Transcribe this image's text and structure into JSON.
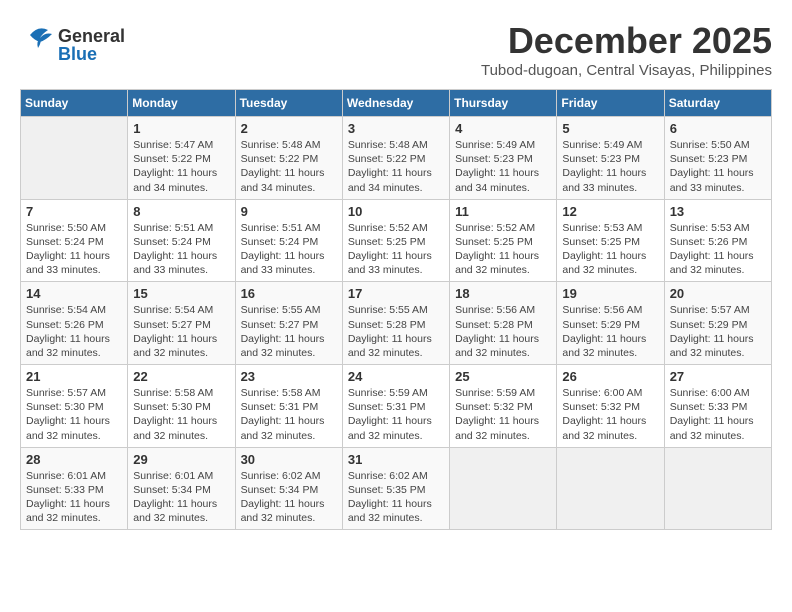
{
  "header": {
    "logo_general": "General",
    "logo_blue": "Blue",
    "month": "December 2025",
    "location": "Tubod-dugoan, Central Visayas, Philippines"
  },
  "columns": [
    "Sunday",
    "Monday",
    "Tuesday",
    "Wednesday",
    "Thursday",
    "Friday",
    "Saturday"
  ],
  "weeks": [
    [
      {
        "day": "",
        "info": ""
      },
      {
        "day": "1",
        "info": "Sunrise: 5:47 AM\nSunset: 5:22 PM\nDaylight: 11 hours\nand 34 minutes."
      },
      {
        "day": "2",
        "info": "Sunrise: 5:48 AM\nSunset: 5:22 PM\nDaylight: 11 hours\nand 34 minutes."
      },
      {
        "day": "3",
        "info": "Sunrise: 5:48 AM\nSunset: 5:22 PM\nDaylight: 11 hours\nand 34 minutes."
      },
      {
        "day": "4",
        "info": "Sunrise: 5:49 AM\nSunset: 5:23 PM\nDaylight: 11 hours\nand 34 minutes."
      },
      {
        "day": "5",
        "info": "Sunrise: 5:49 AM\nSunset: 5:23 PM\nDaylight: 11 hours\nand 33 minutes."
      },
      {
        "day": "6",
        "info": "Sunrise: 5:50 AM\nSunset: 5:23 PM\nDaylight: 11 hours\nand 33 minutes."
      }
    ],
    [
      {
        "day": "7",
        "info": "Sunrise: 5:50 AM\nSunset: 5:24 PM\nDaylight: 11 hours\nand 33 minutes."
      },
      {
        "day": "8",
        "info": "Sunrise: 5:51 AM\nSunset: 5:24 PM\nDaylight: 11 hours\nand 33 minutes."
      },
      {
        "day": "9",
        "info": "Sunrise: 5:51 AM\nSunset: 5:24 PM\nDaylight: 11 hours\nand 33 minutes."
      },
      {
        "day": "10",
        "info": "Sunrise: 5:52 AM\nSunset: 5:25 PM\nDaylight: 11 hours\nand 33 minutes."
      },
      {
        "day": "11",
        "info": "Sunrise: 5:52 AM\nSunset: 5:25 PM\nDaylight: 11 hours\nand 32 minutes."
      },
      {
        "day": "12",
        "info": "Sunrise: 5:53 AM\nSunset: 5:25 PM\nDaylight: 11 hours\nand 32 minutes."
      },
      {
        "day": "13",
        "info": "Sunrise: 5:53 AM\nSunset: 5:26 PM\nDaylight: 11 hours\nand 32 minutes."
      }
    ],
    [
      {
        "day": "14",
        "info": "Sunrise: 5:54 AM\nSunset: 5:26 PM\nDaylight: 11 hours\nand 32 minutes."
      },
      {
        "day": "15",
        "info": "Sunrise: 5:54 AM\nSunset: 5:27 PM\nDaylight: 11 hours\nand 32 minutes."
      },
      {
        "day": "16",
        "info": "Sunrise: 5:55 AM\nSunset: 5:27 PM\nDaylight: 11 hours\nand 32 minutes."
      },
      {
        "day": "17",
        "info": "Sunrise: 5:55 AM\nSunset: 5:28 PM\nDaylight: 11 hours\nand 32 minutes."
      },
      {
        "day": "18",
        "info": "Sunrise: 5:56 AM\nSunset: 5:28 PM\nDaylight: 11 hours\nand 32 minutes."
      },
      {
        "day": "19",
        "info": "Sunrise: 5:56 AM\nSunset: 5:29 PM\nDaylight: 11 hours\nand 32 minutes."
      },
      {
        "day": "20",
        "info": "Sunrise: 5:57 AM\nSunset: 5:29 PM\nDaylight: 11 hours\nand 32 minutes."
      }
    ],
    [
      {
        "day": "21",
        "info": "Sunrise: 5:57 AM\nSunset: 5:30 PM\nDaylight: 11 hours\nand 32 minutes."
      },
      {
        "day": "22",
        "info": "Sunrise: 5:58 AM\nSunset: 5:30 PM\nDaylight: 11 hours\nand 32 minutes."
      },
      {
        "day": "23",
        "info": "Sunrise: 5:58 AM\nSunset: 5:31 PM\nDaylight: 11 hours\nand 32 minutes."
      },
      {
        "day": "24",
        "info": "Sunrise: 5:59 AM\nSunset: 5:31 PM\nDaylight: 11 hours\nand 32 minutes."
      },
      {
        "day": "25",
        "info": "Sunrise: 5:59 AM\nSunset: 5:32 PM\nDaylight: 11 hours\nand 32 minutes."
      },
      {
        "day": "26",
        "info": "Sunrise: 6:00 AM\nSunset: 5:32 PM\nDaylight: 11 hours\nand 32 minutes."
      },
      {
        "day": "27",
        "info": "Sunrise: 6:00 AM\nSunset: 5:33 PM\nDaylight: 11 hours\nand 32 minutes."
      }
    ],
    [
      {
        "day": "28",
        "info": "Sunrise: 6:01 AM\nSunset: 5:33 PM\nDaylight: 11 hours\nand 32 minutes."
      },
      {
        "day": "29",
        "info": "Sunrise: 6:01 AM\nSunset: 5:34 PM\nDaylight: 11 hours\nand 32 minutes."
      },
      {
        "day": "30",
        "info": "Sunrise: 6:02 AM\nSunset: 5:34 PM\nDaylight: 11 hours\nand 32 minutes."
      },
      {
        "day": "31",
        "info": "Sunrise: 6:02 AM\nSunset: 5:35 PM\nDaylight: 11 hours\nand 32 minutes."
      },
      {
        "day": "",
        "info": ""
      },
      {
        "day": "",
        "info": ""
      },
      {
        "day": "",
        "info": ""
      }
    ]
  ]
}
